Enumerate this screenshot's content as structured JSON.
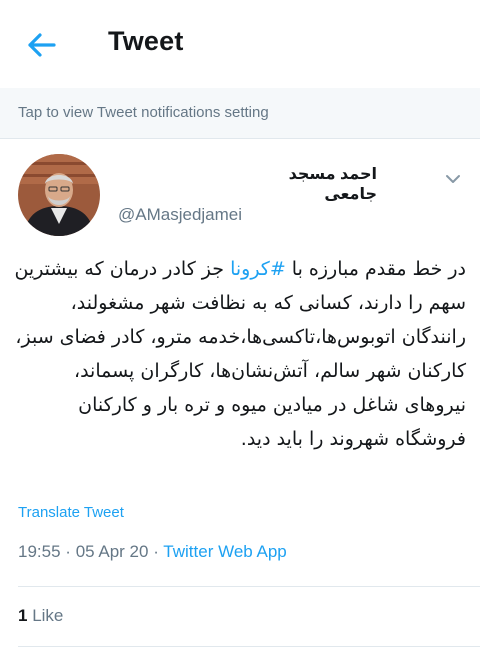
{
  "header": {
    "title": "Tweet"
  },
  "banner": {
    "text": "Tap to view Tweet notifications setting"
  },
  "tweet": {
    "author_name": "احمد مسجد جامعی",
    "author_handle": "@AMasjedjamei",
    "body_prefix": "در خط مقدم مبارزه با ",
    "hashtag": "#کرونا",
    "body_suffix": " جز کادر درمان که بیشترین سهم را دارند، کسانی که به نظافت شهر مشغولند، رانندگان اتوبوس‌ها،تاکسی‌ها،خدمه مترو، کادر فضای سبز، کارکنان شهر سالم، آتش‌نشان‌ها، کارگران پسماند، نیروهای شاغل در میادین میوه و تره بار و کارکنان فروشگاه شهروند را باید دید.",
    "translate_label": "Translate Tweet",
    "time": "19:55",
    "date": "05 Apr 20",
    "separator": "·",
    "source": "Twitter Web App",
    "like_count": "1",
    "like_label": "Like"
  },
  "colors": {
    "accent": "#1da1f2",
    "text": "#14171a",
    "muted": "#657786"
  }
}
